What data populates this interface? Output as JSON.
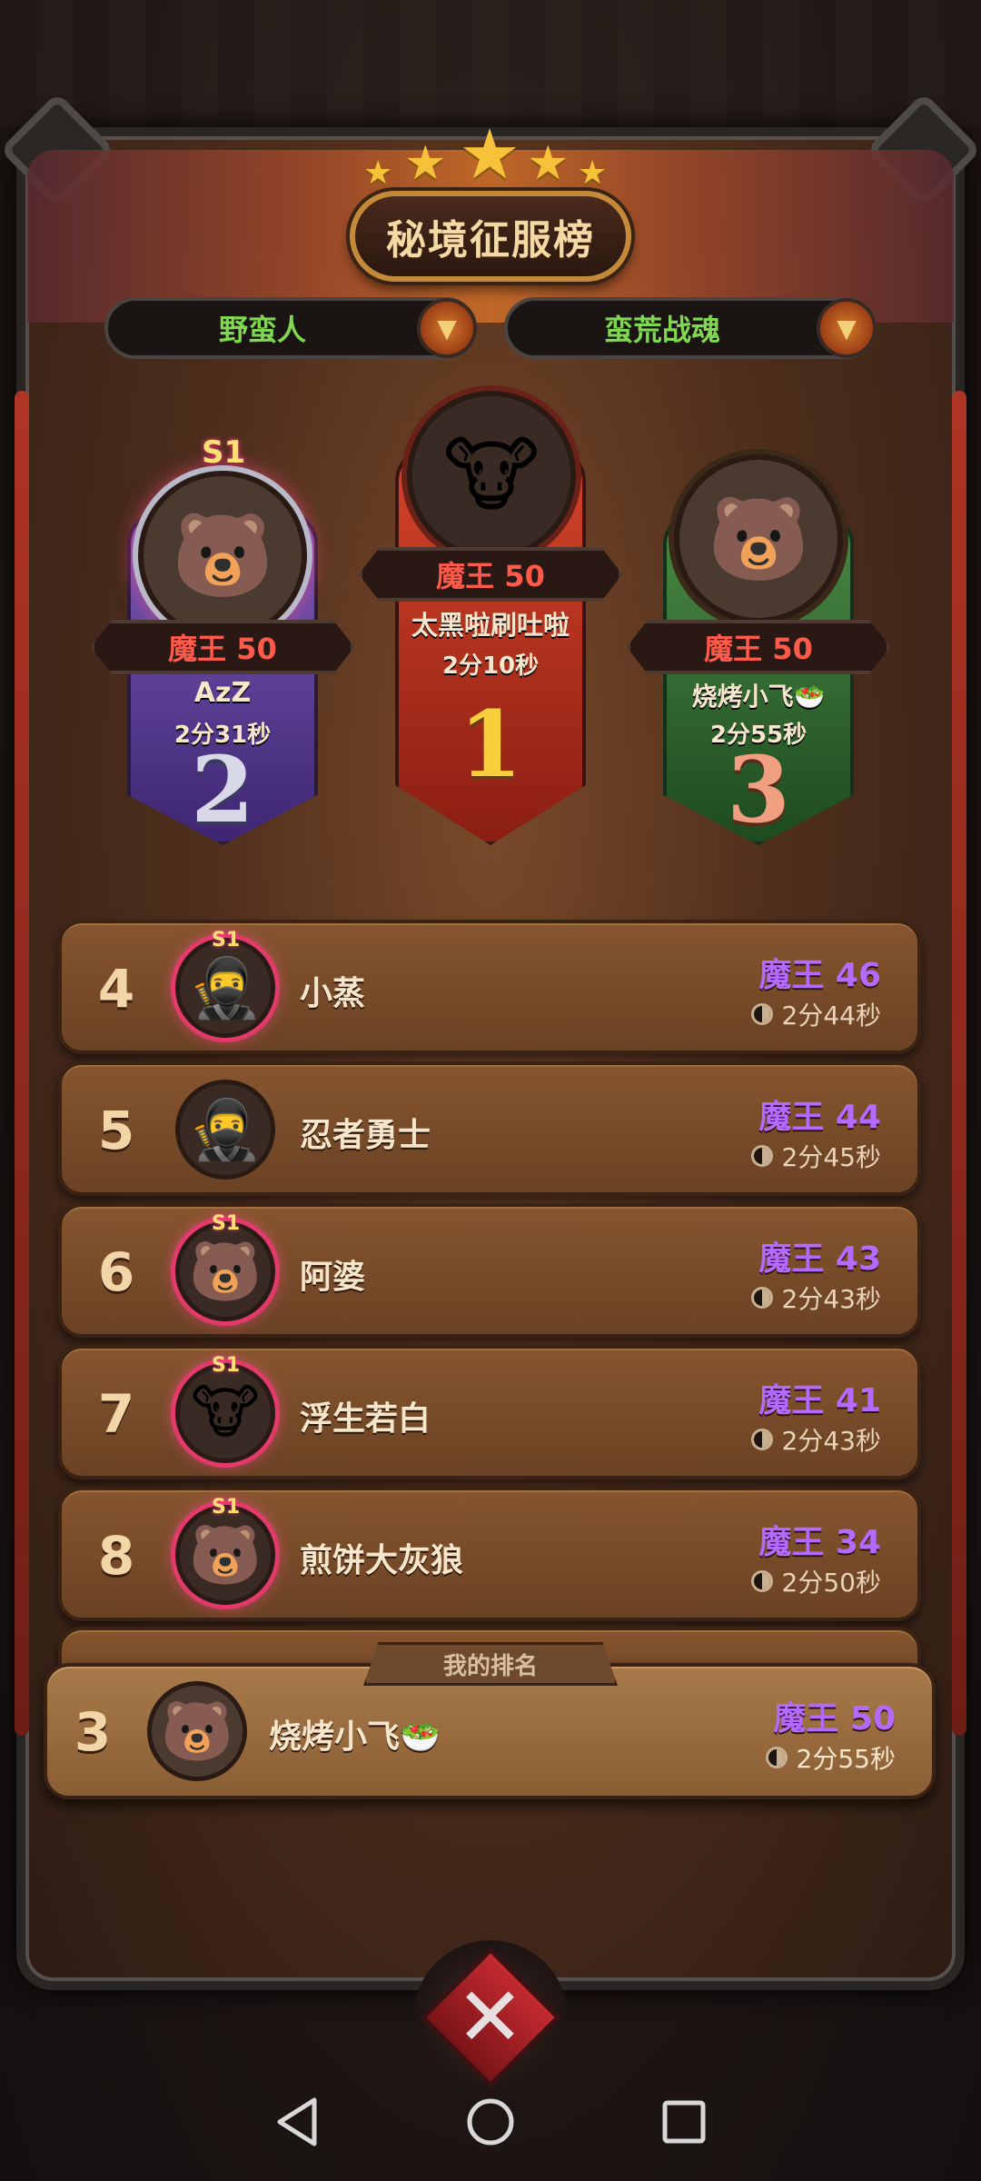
{
  "header": {
    "title": "秘境征服榜",
    "filters": [
      {
        "label": "野蛮人"
      },
      {
        "label": "蛮荒战魂"
      }
    ]
  },
  "podium": {
    "first": {
      "rank": "1",
      "level": "魔王 50",
      "name": "太黑啦刷吐啦",
      "time": "2分10秒"
    },
    "second": {
      "rank": "2",
      "level": "魔王 50",
      "name": "AzZ",
      "time": "2分31秒",
      "season_badge": "S1"
    },
    "third": {
      "rank": "3",
      "level": "魔王 50",
      "name": "烧烤小飞🥗",
      "time": "2分55秒"
    }
  },
  "list": [
    {
      "rank": "4",
      "name": "小蒸",
      "level": "魔王 46",
      "time": "2分44秒",
      "badge": "S1"
    },
    {
      "rank": "5",
      "name": "忍者勇士",
      "level": "魔王 44",
      "time": "2分45秒",
      "badge": ""
    },
    {
      "rank": "6",
      "name": "阿婆",
      "level": "魔王 43",
      "time": "2分43秒",
      "badge": "S1"
    },
    {
      "rank": "7",
      "name": "浮生若白",
      "level": "魔王 41",
      "time": "2分43秒",
      "badge": "S1"
    },
    {
      "rank": "8",
      "name": "煎饼大灰狼",
      "level": "魔王 34",
      "time": "2分50秒",
      "badge": "S1"
    }
  ],
  "my_rank": {
    "tab_label": "我的排名",
    "rank": "3",
    "name": "烧烤小飞🥗",
    "level": "魔王 50",
    "time": "2分55秒"
  },
  "colors": {
    "level_purple": "#b46aff",
    "level_red": "#ff5a4a",
    "filter_green": "#7fd850",
    "first_ribbon": "#b8321e",
    "second_ribbon": "#5a3a9a",
    "third_ribbon": "#3a7a3a"
  },
  "icons": {
    "dropdown": "chevron-down-icon",
    "close": "close-x-icon",
    "clock": "clock-icon",
    "nav_back": "back-triangle-icon",
    "nav_home": "home-circle-icon",
    "nav_recents": "recents-square-icon"
  }
}
